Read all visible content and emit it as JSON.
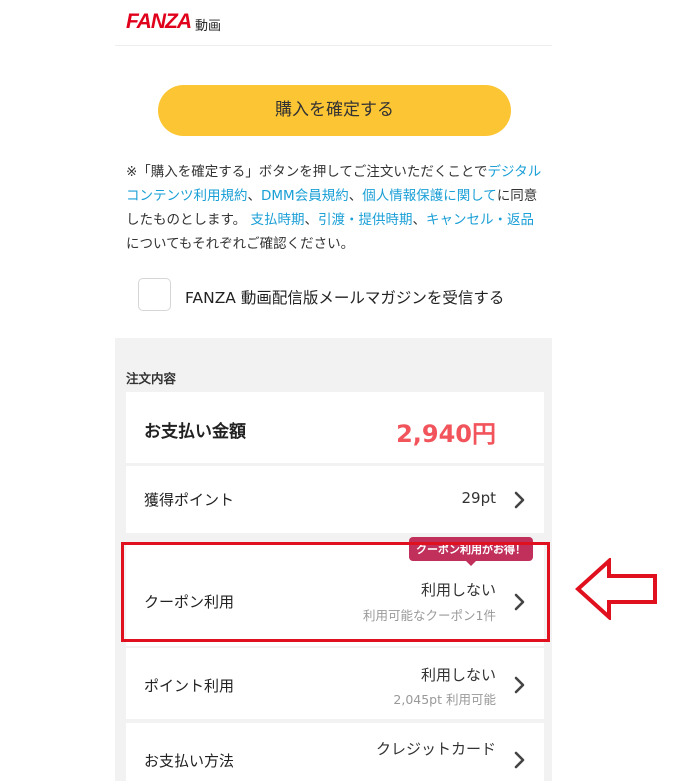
{
  "header": {
    "logo": "FANZA",
    "logo_sub": "動画"
  },
  "purchase_button": "購入を確定する",
  "notice": {
    "part1": "※「購入を確定する」ボタンを押してご注文いただくことで",
    "link_terms": "デジタルコンテンツ利用規約",
    "sep1": "、",
    "link_member": "DMM会員規約",
    "sep2": "、",
    "link_privacy": "個人情報保護に関して",
    "part2": "に同意したものとします。",
    "link_payment_timing": "支払時期",
    "sep3": "、",
    "link_delivery": "引渡・提供時期",
    "sep4": "、",
    "link_cancel": "キャンセル・返品",
    "part3": "についてもそれぞれご確認ください。"
  },
  "newsletter": {
    "label": "FANZA 動画配信版メールマガジンを受信する"
  },
  "order": {
    "section_title": "注文内容",
    "total": {
      "label": "お支払い金額",
      "amount": "2,940円"
    },
    "points": {
      "label": "獲得ポイント",
      "value": "29pt"
    },
    "coupon": {
      "badge": "クーポン利用がお得！",
      "label": "クーポン利用",
      "value": "利用しない",
      "sub": "利用可能なクーポン1件"
    },
    "point_use": {
      "label": "ポイント利用",
      "value": "利用しない",
      "sub": "2,045pt 利用可能"
    },
    "payment": {
      "label": "お支払い方法",
      "value": "クレジットカード"
    }
  },
  "colors": {
    "accent_button": "#fcc533",
    "brand_red": "#e0001b",
    "link_blue": "#1a9fd6",
    "price_red": "#f2545b",
    "badge": "#c0305a",
    "annotation_red": "#e0101e"
  }
}
